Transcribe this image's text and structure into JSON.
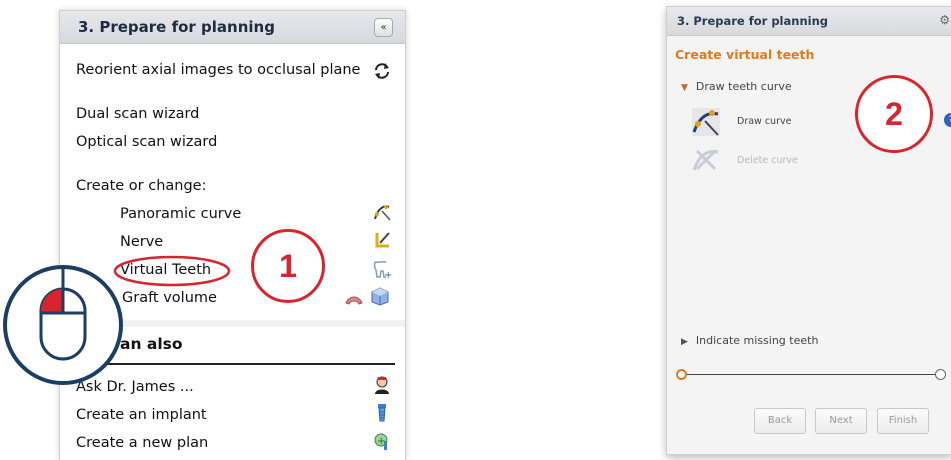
{
  "left_panel": {
    "title": "3. Prepare for planning",
    "collapse_glyph": "«",
    "reorient": "Reorient axial images to occlusal plane",
    "dual_scan": "Dual scan wizard",
    "optical_scan": "Optical scan wizard",
    "create_or_change": "Create or change:",
    "items": {
      "panoramic": "Panoramic curve",
      "nerve": "Nerve",
      "virtual_teeth": "Virtual Teeth",
      "graft": "Graft volume"
    },
    "also_title": "an also",
    "also_items": {
      "ask": "Ask Dr. James ...",
      "implant": "Create an implant",
      "new_plan": "Create a new plan"
    }
  },
  "callouts": {
    "one": "1",
    "two": "2"
  },
  "right_panel": {
    "title": "3. Prepare for planning",
    "gear_glyph": "⚙",
    "section": "Create virtual teeth",
    "draw_curve_group": "Draw teeth curve",
    "draw_curve": "Draw curve",
    "delete_curve": "Delete curve",
    "help_glyph": "?",
    "missing_teeth": "Indicate missing teeth",
    "buttons": {
      "back": "Back",
      "next": "Next",
      "finish": "Finish"
    }
  },
  "colors": {
    "accent_red": "#d8242c",
    "navy": "#1b3f63",
    "orange": "#e07a1f"
  }
}
